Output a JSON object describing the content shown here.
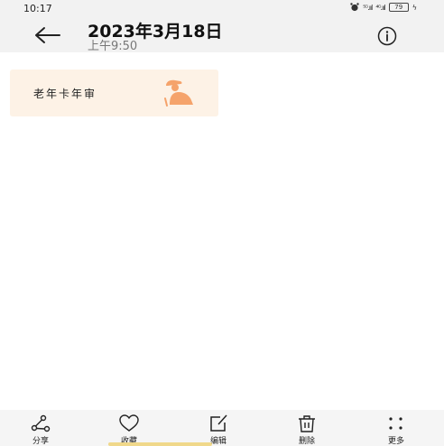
{
  "status_bar": {
    "time": "10:17",
    "signal_1": "⁵ᴳ.ııl",
    "signal_2": "⁴ᴳ.ııl",
    "battery": "79"
  },
  "header": {
    "title": "2023年3月18日",
    "subtitle": "上午9:50"
  },
  "content": {
    "card_text": "老年卡年审"
  },
  "bottom_bar": {
    "share_label": "分享",
    "favorite_label": "收藏",
    "edit_label": "编辑",
    "delete_label": "删除",
    "more_label": "更多"
  },
  "colors": {
    "accent": "#f5a36b",
    "card_bg": "#fdf2e6",
    "bar_bg": "#f2f2f2"
  }
}
